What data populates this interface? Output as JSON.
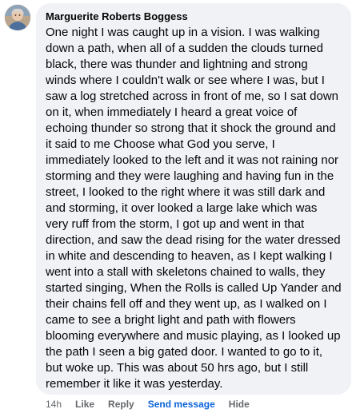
{
  "comment": {
    "author": "Marguerite Roberts Boggess",
    "text": "One night I was caught up in a vision. I was walking down a path, when all of a sudden the clouds turned black, there was thunder and lightning and strong winds where I couldn't walk or see where I was, but I saw a log stretched across in front of me, so I sat down on it, when immediately I heard a great voice of echoing thunder so strong that it shock the ground and it said to me Choose what God you serve, I immediately looked to the left and it was not raining nor storming and they were laughing and having fun in the street, I looked to the right where it was still dark and and storming, it over looked a large lake which was very ruff from the storm, I got up and went in that direction, and saw the dead rising for the water dressed in white and descending to heaven, as I kept walking I went into a stall with skeletons chained to walls, they started singing, When the Rolls is called Up Yander and their chains fell off and they went up, as I walked on I came to see a bright light and path with flowers blooming everywhere and music playing, as I looked up the path I seen a big gated door. I wanted to go to it, but woke up. This was about 50 hrs ago, but I still remember it like it was yesterday.",
    "timestamp": "14h",
    "actions": {
      "like": "Like",
      "reply": "Reply",
      "send_message": "Send message",
      "hide": "Hide"
    },
    "avatar_icon": "profile-photo-icon"
  },
  "colors": {
    "bubble_background": "#f0f2f5",
    "text_primary": "#050505",
    "text_secondary": "#65676b",
    "link_accent": "#0a63d8"
  }
}
